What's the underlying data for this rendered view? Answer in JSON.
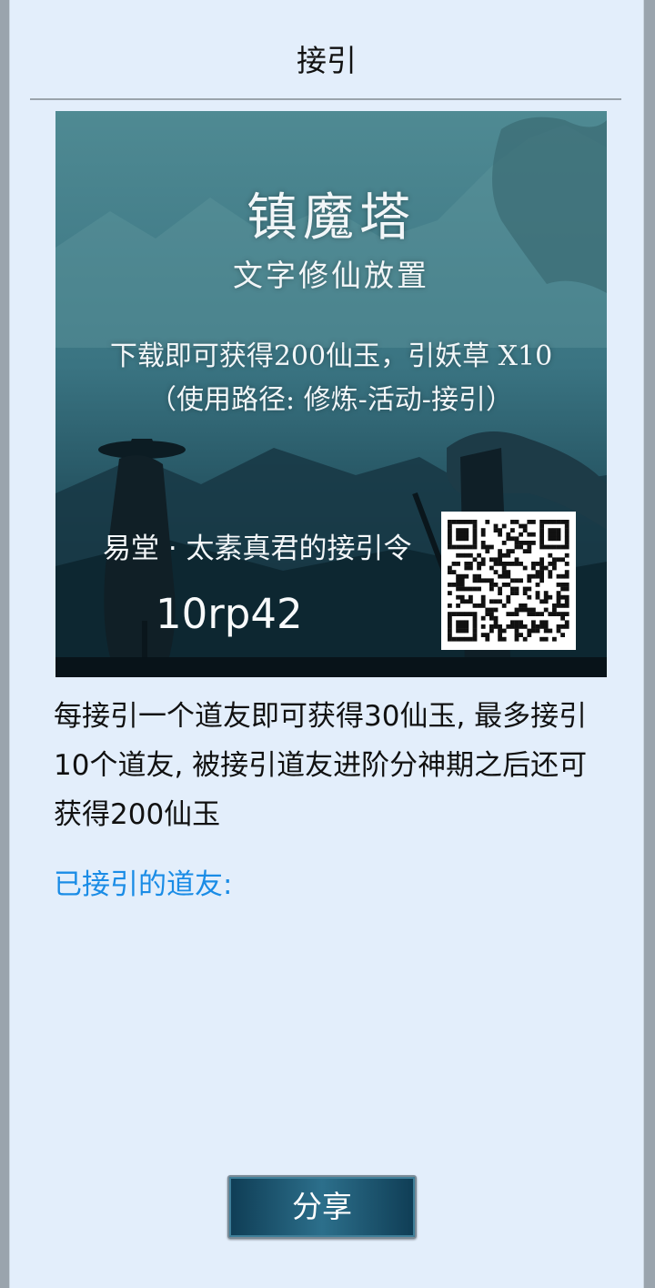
{
  "header": {
    "title": "接引"
  },
  "poster": {
    "game_name": "镇魔塔",
    "game_subtitle": "文字修仙放置",
    "reward_line": "下载即可获得200仙玉，引妖草 X10",
    "usage_line": "（使用路径: 修炼-活动-接引）",
    "invite_label": "易堂 · 太素真君的接引令",
    "invite_code": "10rp42"
  },
  "main": {
    "description": "每接引一个道友即可获得30仙玉, 最多接引10个道友, 被接引道友进阶分神期之后还可获得200仙玉",
    "invited_label": "已接引的道友:"
  },
  "footer": {
    "share_label": "分享"
  },
  "colors": {
    "accent_link": "#1a8ce6",
    "panel_bg": "#e3eefb",
    "button_bg": "#1c5470"
  }
}
